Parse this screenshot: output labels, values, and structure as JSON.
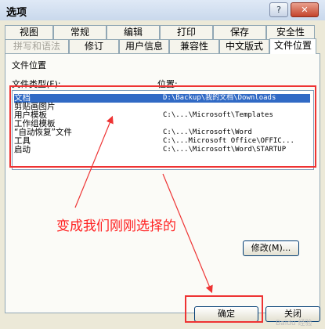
{
  "window": {
    "title": "选项",
    "help_glyph": "?",
    "close_glyph": "✕"
  },
  "tabs_top": [
    "视图",
    "常规",
    "编辑",
    "打印",
    "保存",
    "安全性"
  ],
  "tabs_bottom": [
    "拼写和语法",
    "修订",
    "用户信息",
    "兼容性",
    "中文版式",
    "文件位置"
  ],
  "active_tab": "文件位置",
  "panel": {
    "section_title": "文件位置",
    "col_type": "文件类型(F):",
    "col_location": "位置:"
  },
  "file_locations": [
    {
      "type": "文档",
      "location": "D:\\Backup\\我的文档\\Downloads",
      "selected": true
    },
    {
      "type": "剪贴画图片",
      "location": ""
    },
    {
      "type": "用户模板",
      "location": "C:\\...\\Microsoft\\Templates"
    },
    {
      "type": "工作组模板",
      "location": ""
    },
    {
      "type": "“自动恢复”文件",
      "location": "C:\\...\\Microsoft\\Word"
    },
    {
      "type": "工具",
      "location": "C:\\...Microsoft Office\\OFFIC..."
    },
    {
      "type": "启动",
      "location": "C:\\...\\Microsoft\\Word\\STARTUP"
    }
  ],
  "annotation": "变成我们刚刚选择的",
  "buttons": {
    "modify": "修改(M)...",
    "ok": "确定",
    "close": "关闭"
  },
  "watermark": "Baidu 经验",
  "colors": {
    "annotation_red": "#e33333",
    "selection": "#316ac5"
  }
}
